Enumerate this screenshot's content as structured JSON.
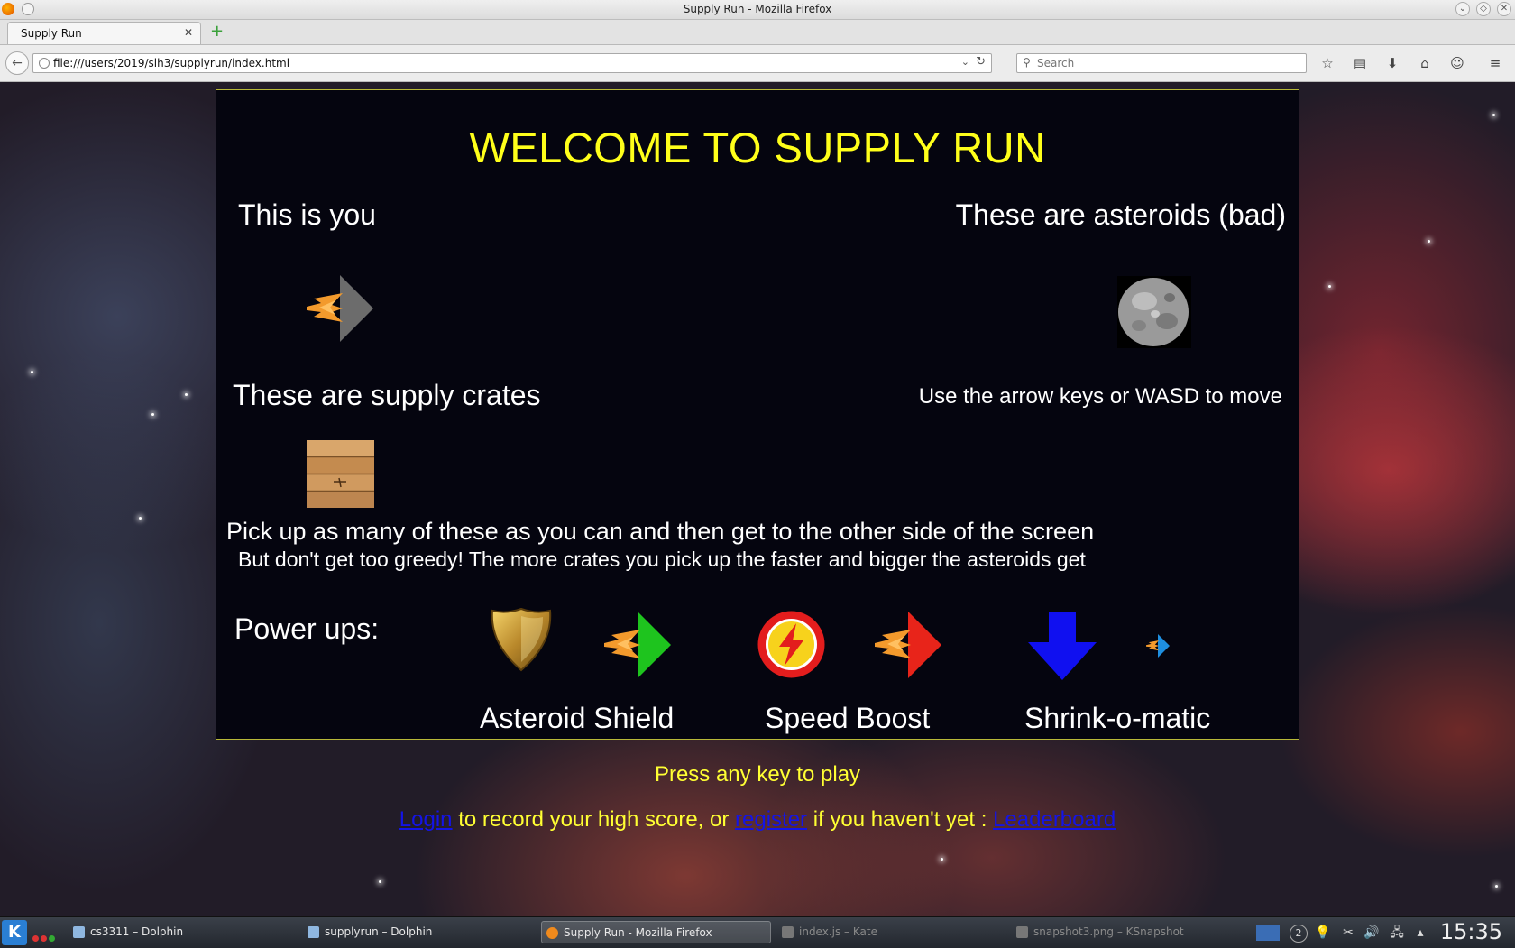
{
  "window": {
    "title": "Supply Run - Mozilla Firefox"
  },
  "tab": {
    "label": "Supply Run",
    "close": "✕"
  },
  "nav": {
    "url": "file:///users/2019/slh3/supplyrun/index.html",
    "search_placeholder": "Search"
  },
  "page": {
    "title": "WELCOME TO SUPPLY RUN",
    "player_label": "This is you",
    "asteroid_label": "These are asteroids (bad)",
    "crate_label": "These are supply crates",
    "move_label": "Use the arrow keys or WASD to move",
    "pickup_line": "Pick up as many of these as you can and then get to the other side of the screen",
    "greedy_line": "But don't get too greedy! The more crates you pick up the faster and bigger the asteroids get",
    "powerups_label": "Power ups:",
    "powerups": [
      {
        "name": "Asteroid Shield",
        "icon": "shield-icon",
        "ship_color": "#1ec41e"
      },
      {
        "name": "Speed Boost",
        "icon": "lightning-icon",
        "ship_color": "#e8241a"
      },
      {
        "name": "Shrink-o-matic",
        "icon": "down-arrow-icon",
        "ship_color": "#1e8fe0"
      }
    ],
    "press_key": "Press any key to play",
    "login_link": "Login",
    "login_mid": " to record your high score, or ",
    "register_link": "register",
    "register_mid": " if you haven't yet : ",
    "leaderboard_link": "Leaderboard"
  },
  "colors": {
    "title_yellow": "#ffff1a",
    "link_blue": "#1414e6",
    "panel_border": "#b8b838"
  },
  "taskbar": {
    "tasks": [
      {
        "label": "cs3311 – Dolphin",
        "state": "normal"
      },
      {
        "label": "supplyrun – Dolphin",
        "state": "normal"
      },
      {
        "label": "Supply Run - Mozilla Firefox",
        "state": "active"
      },
      {
        "label": "index.js – Kate",
        "state": "dim"
      },
      {
        "label": "snapshot3.png – KSnapshot",
        "state": "dim"
      }
    ],
    "clock": "15:35",
    "badge": "2"
  }
}
